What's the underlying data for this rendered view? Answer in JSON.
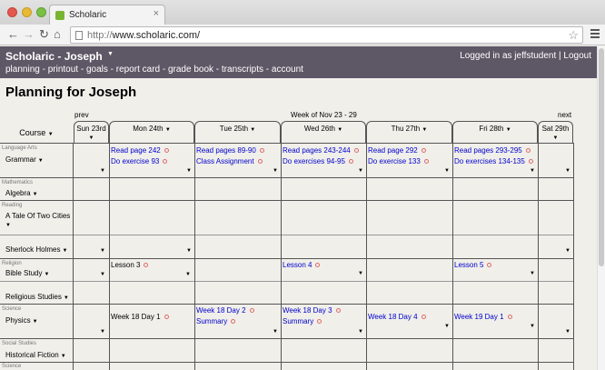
{
  "browser": {
    "tab_title": "Scholaric",
    "tab_close": "×",
    "url_scheme": "http://",
    "url_rest": "www.scholaric.com/",
    "back": "←",
    "forward": "→",
    "reload": "↻",
    "home": "⌂",
    "star": "☆"
  },
  "header": {
    "title": "Scholaric - Joseph",
    "title_caret": "▼",
    "nav": "planning - printout - goals - report card - grade book - transcripts - account",
    "login_status": "Logged in as jeffstudent | Logout"
  },
  "page": {
    "title": "Planning for Joseph",
    "prev": "prev",
    "next": "next",
    "week": "Week of Nov 23 - 29",
    "course_header": "Course"
  },
  "days": [
    {
      "label": "Sun 23rd"
    },
    {
      "label": "Mon 24th"
    },
    {
      "label": "Tue 25th"
    },
    {
      "label": "Wed 26th"
    },
    {
      "label": "Thu 27th"
    },
    {
      "label": "Fri 28th"
    },
    {
      "label": "Sat 29th"
    }
  ],
  "caret": "▼",
  "rows": [
    {
      "subject": "Language Arts",
      "course": "Grammar"
    },
    {
      "subject": "Mathematics",
      "course": "Algebra"
    },
    {
      "subject": "Reading",
      "course": "A Tale Of Two Cities"
    },
    {
      "subject": "",
      "course": "Sherlock Holmes"
    },
    {
      "subject": "Religion",
      "course": "Bible Study"
    },
    {
      "subject": "",
      "course": "Religious Studies"
    },
    {
      "subject": "Science",
      "course": "Physics"
    },
    {
      "subject": "Social Studies",
      "course": "Historical Fiction"
    },
    {
      "subject": "Science",
      "course": ""
    }
  ],
  "entries": {
    "grammar_mon_1": "Read page 242",
    "grammar_mon_2": "Do exercise 93",
    "grammar_tue_1": "Read pages 89-90",
    "grammar_tue_2": "Class Assignment",
    "grammar_wed_1": "Read pages 243-244",
    "grammar_wed_2": "Do exercises 94-95",
    "grammar_thu_1": "Read page 292",
    "grammar_thu_2": "Do exercise 133",
    "grammar_fri_1": "Read pages 293-295",
    "grammar_fri_2": "Do exercises 134-135",
    "bible_mon": "Lesson 3",
    "bible_wed": "Lesson 4",
    "bible_fri": "Lesson 5",
    "physics_mon": "Week 18 Day 1",
    "physics_tue_1": "Week 18 Day 2",
    "physics_tue_2": "Summary",
    "physics_wed_1": "Week 18 Day 3",
    "physics_wed_2": "Summary",
    "physics_thu": "Week 18 Day 4",
    "physics_fri": "Week 19 Day 1"
  }
}
